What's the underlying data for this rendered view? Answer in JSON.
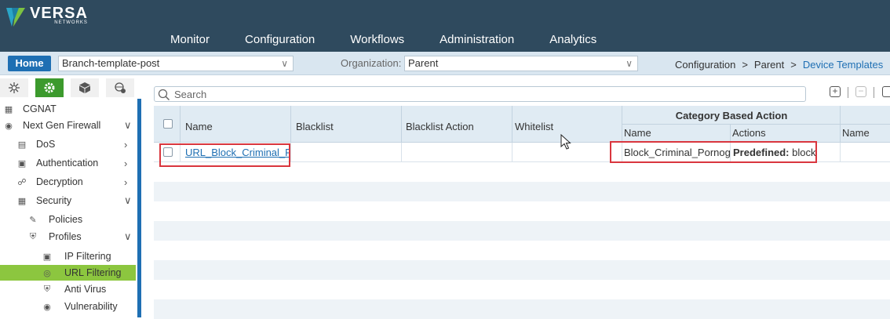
{
  "brand": {
    "name": "VERSA",
    "sub": "NETWORKS"
  },
  "mainnav": [
    "Monitor",
    "Configuration",
    "Workflows",
    "Administration",
    "Analytics"
  ],
  "subbar": {
    "home_label": "Home",
    "template": "Branch-template-post",
    "org_label": "Organization:",
    "org_value": "Parent",
    "breadcrumb": [
      "Configuration",
      "Parent",
      "Device Templates"
    ]
  },
  "sidebar": {
    "tabs": [
      "network-icon",
      "gear-icon",
      "cube-icon",
      "globe-gear-icon"
    ],
    "items": [
      {
        "label": "CGNAT",
        "icon": "cgnat-icon"
      },
      {
        "label": "Next Gen Firewall",
        "icon": "firewall-icon"
      },
      {
        "label": "DoS",
        "icon": "dos-icon"
      },
      {
        "label": "Authentication",
        "icon": "auth-icon"
      },
      {
        "label": "Decryption",
        "icon": "unlock-icon"
      },
      {
        "label": "Security",
        "icon": "security-icon"
      },
      {
        "label": "Policies",
        "icon": "policy-icon"
      },
      {
        "label": "Profiles",
        "icon": "shield-icon"
      },
      {
        "label": "IP Filtering",
        "icon": "monitor-icon"
      },
      {
        "label": "URL Filtering",
        "icon": "globe-icon"
      },
      {
        "label": "Anti Virus",
        "icon": "antivirus-icon"
      },
      {
        "label": "Vulnerability",
        "icon": "vulnerability-icon"
      }
    ]
  },
  "toolbar": {
    "search_placeholder": "Search"
  },
  "table": {
    "headers": {
      "name": "Name",
      "blacklist": "Blacklist",
      "blacklist_action": "Blacklist Action",
      "whitelist": "Whitelist",
      "category_group": "Category Based Action",
      "cat_name": "Name",
      "cat_actions": "Actions",
      "next_name": "Name"
    },
    "rows": [
      {
        "name": "URL_Block_Criminal_P...",
        "blacklist": "",
        "blacklist_action": "",
        "whitelist": "",
        "cat_name": "Block_Criminal_Pornogra",
        "cat_action_bold": "Predefined:",
        "cat_action_value": "block"
      }
    ]
  },
  "colors": {
    "topbar": "#2f4a5e",
    "accent": "#1e6fb3",
    "selected": "#8cc63f",
    "highlight": "#d9363e"
  }
}
